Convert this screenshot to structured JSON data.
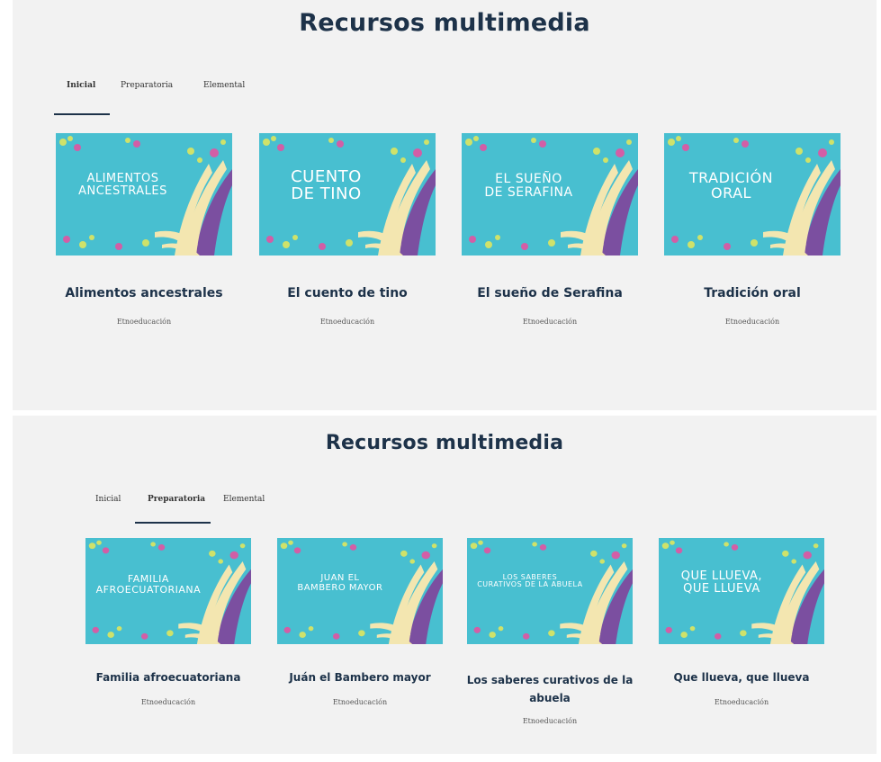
{
  "panels": [
    {
      "title": "Recursos multimedia",
      "tabs": [
        "Inicial",
        "Preparatoria",
        "Elemental"
      ],
      "active_tab": "Inicial",
      "cards": [
        {
          "thumb_lines": [
            "ALIMENTOS",
            "ANCESTRALES"
          ],
          "title": "Alimentos ancestrales",
          "source": "Etnoeducación"
        },
        {
          "thumb_lines": [
            "CUENTO",
            "DE TINO"
          ],
          "title": "El cuento de tino",
          "source": "Etnoeducación"
        },
        {
          "thumb_lines": [
            "EL SUEÑO",
            "DE SERAFINA"
          ],
          "title": "El sueño de Serafina",
          "source": "Etnoeducación"
        },
        {
          "thumb_lines": [
            "TRADICIÓN",
            "ORAL"
          ],
          "title": "Tradición oral",
          "source": "Etnoeducación"
        }
      ]
    },
    {
      "title": "Recursos multimedia",
      "tabs": [
        "Inicial",
        "Preparatoria",
        "Elemental"
      ],
      "active_tab": "Preparatoria",
      "cards": [
        {
          "thumb_lines": [
            "FAMILIA",
            "AFROECUATORIANA"
          ],
          "title": "Familia afroecuatoriana",
          "source": "Etnoeducación"
        },
        {
          "thumb_lines": [
            "JUAN EL",
            "BAMBERO MAYOR"
          ],
          "title": "Juán el Bambero mayor",
          "source": "Etnoeducación"
        },
        {
          "thumb_lines": [
            "LOS SABERES",
            "CURATIVOS DE LA ABUELA"
          ],
          "title": "Los saberes curativos de la abuela",
          "source": "Etnoeducación"
        },
        {
          "thumb_lines": [
            "QUE LLUEVA,",
            "QUE LLUEVA"
          ],
          "title": "Que llueva, que llueva",
          "source": "Etnoeducación"
        }
      ]
    }
  ],
  "colors": {
    "panel_bg": "#f2f2f2",
    "title": "#1d3249",
    "thumb_bg": "#48bfd0",
    "petal_cream": "#f3e6b0",
    "petal_purple": "#7b4fa0",
    "dot_pink": "#d25ea6",
    "dot_lime": "#cfe26a"
  }
}
